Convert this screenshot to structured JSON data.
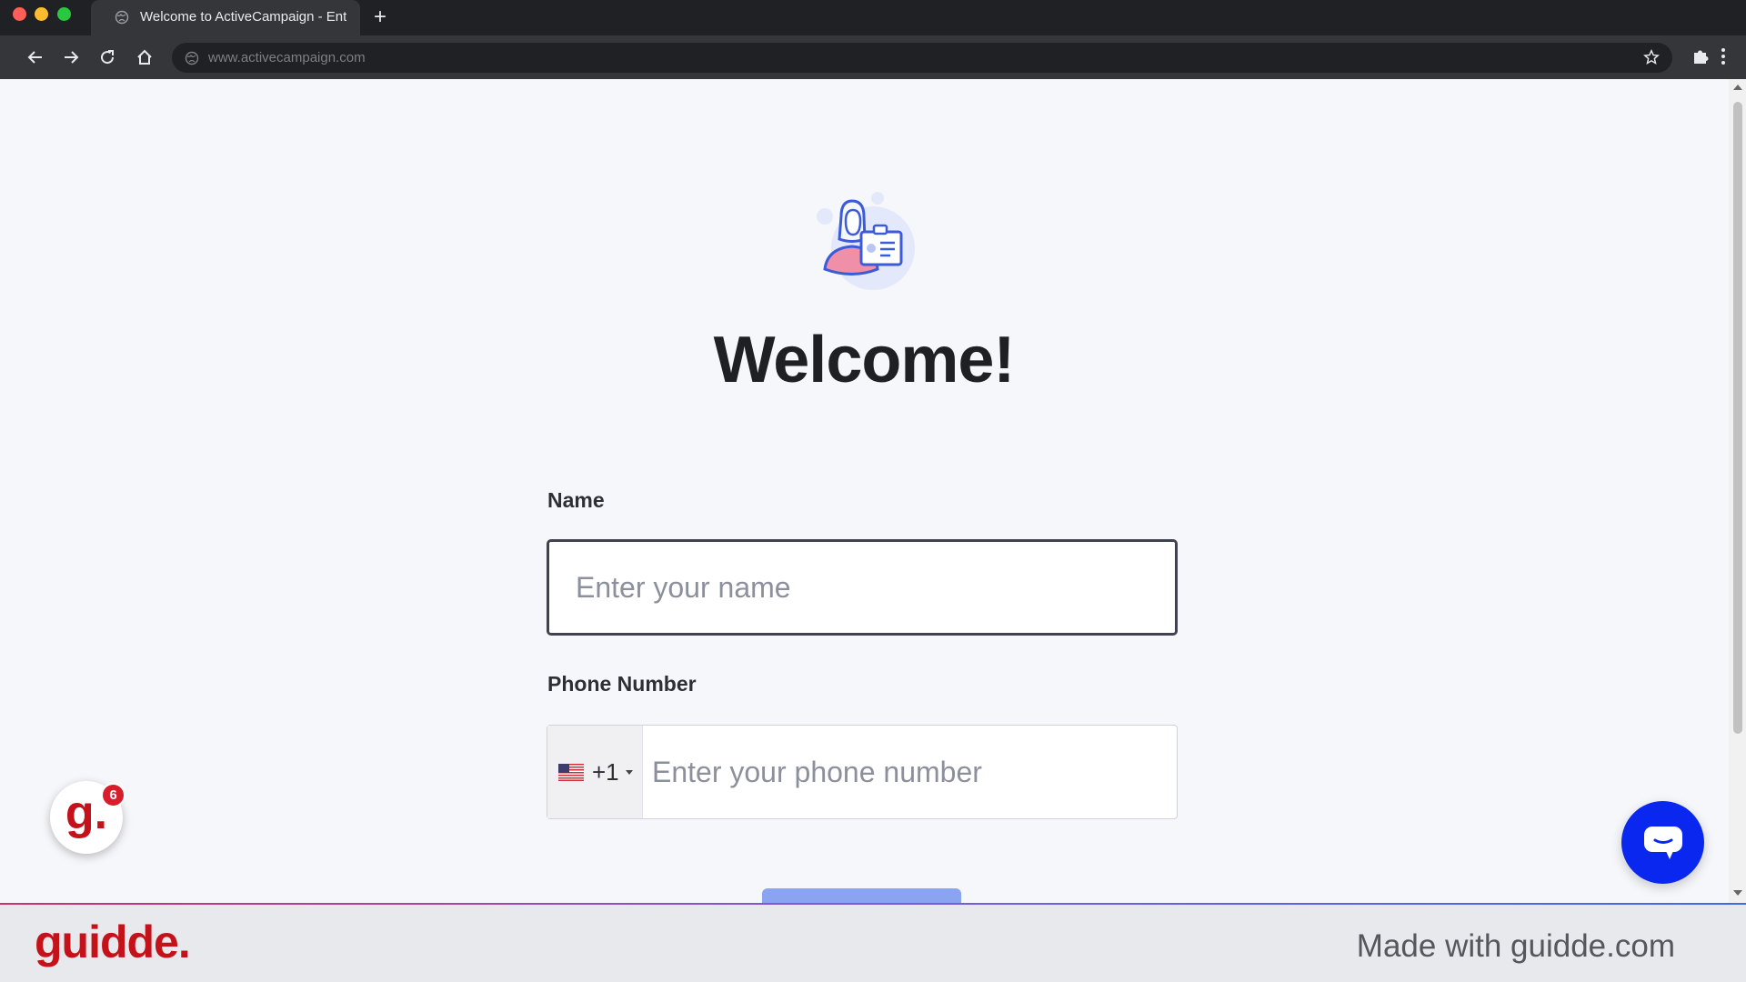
{
  "browser": {
    "tab_title": "Welcome to ActiveCampaign - Ent",
    "new_tab_symbol": "+",
    "url": "www.activecampaign.com"
  },
  "page": {
    "heading": "Welcome!",
    "name_label": "Name",
    "name_placeholder": "Enter your name",
    "phone_label": "Phone Number",
    "phone_country_code": "+1",
    "phone_placeholder": "Enter your phone number",
    "accent_color": "#0a27f0"
  },
  "overlays": {
    "guidde_badge_letter": "g.",
    "guidde_badge_count": "6"
  },
  "footer": {
    "logo": "guidde.",
    "credit": "Made with guidde.com"
  }
}
